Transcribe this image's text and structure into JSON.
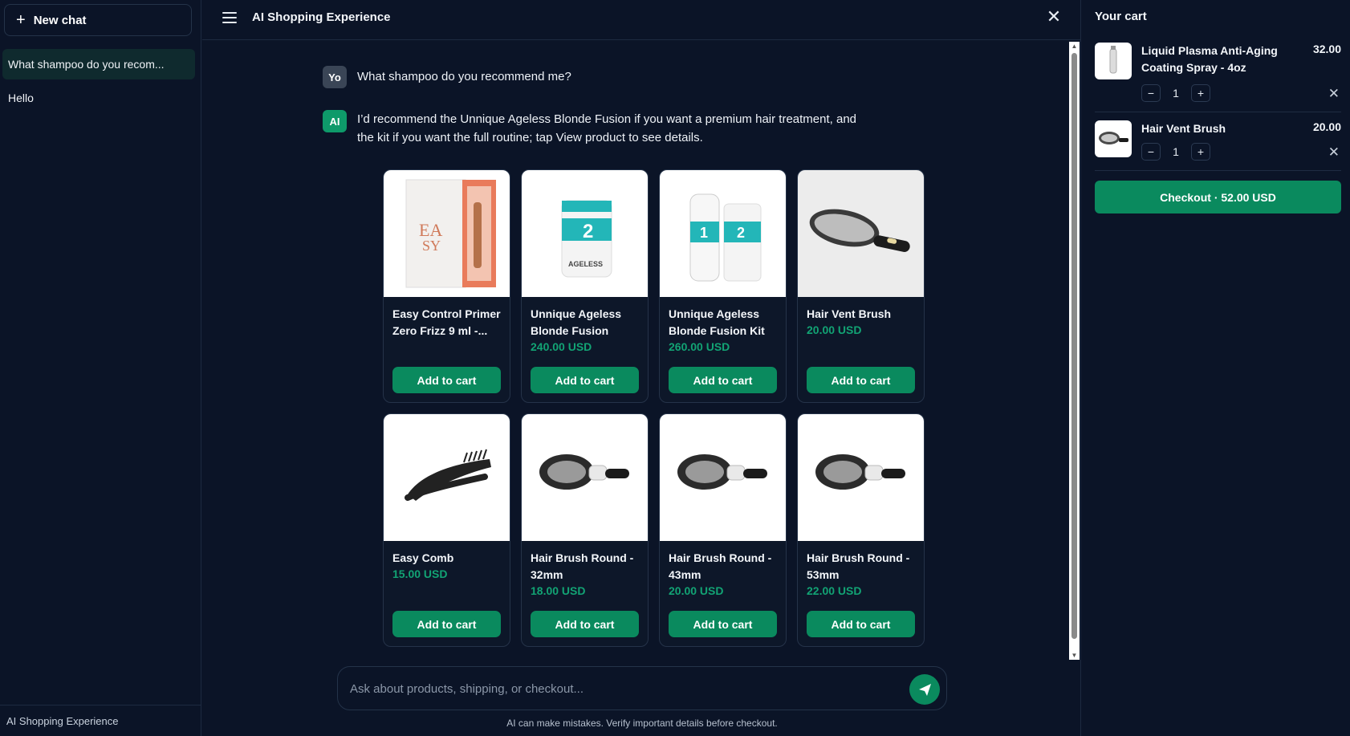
{
  "sidebar": {
    "new_chat_label": "New chat",
    "history": [
      "What shampoo do you recom...",
      "Hello"
    ],
    "footer": "AI Shopping Experience"
  },
  "header": {
    "title": "AI Shopping Experience"
  },
  "conversation": {
    "user_avatar": "Yo",
    "user_message": "What shampoo do you recommend me?",
    "ai_avatar": "AI",
    "ai_message": "I’d recommend the Unnique Ageless Blonde Fusion if you want a premium hair treatment, and the kit if you want the full routine; tap View product to see details."
  },
  "products": [
    {
      "name": "Easy Control Primer Zero Frizz 9 ml -...",
      "price": "",
      "button": "Add to cart",
      "image": "primer-box"
    },
    {
      "name": "Unnique Ageless Blonde Fusion",
      "price": "240.00 USD",
      "button": "Add to cart",
      "image": "jar"
    },
    {
      "name": "Unnique Ageless Blonde Fusion Kit",
      "price": "260.00 USD",
      "button": "Add to cart",
      "image": "kit"
    },
    {
      "name": "Hair Vent Brush",
      "price": "20.00 USD",
      "button": "Add to cart",
      "image": "vent-brush"
    },
    {
      "name": "Easy Comb",
      "price": "15.00 USD",
      "button": "Add to cart",
      "image": "comb"
    },
    {
      "name": "Hair Brush Round - 32mm",
      "price": "18.00 USD",
      "button": "Add to cart",
      "image": "round-brush"
    },
    {
      "name": "Hair Brush Round - 43mm",
      "price": "20.00 USD",
      "button": "Add to cart",
      "image": "round-brush"
    },
    {
      "name": "Hair Brush Round - 53mm",
      "price": "22.00 USD",
      "button": "Add to cart",
      "image": "round-brush"
    }
  ],
  "composer": {
    "placeholder": "Ask about products, shipping, or checkout...",
    "disclaimer": "AI can make mistakes. Verify important details before checkout."
  },
  "cart": {
    "title": "Your cart",
    "items": [
      {
        "name": "Liquid Plasma Anti-Aging Coating Spray - 4oz",
        "price": "32.00",
        "qty": "1"
      },
      {
        "name": "Hair Vent Brush",
        "price": "20.00",
        "qty": "1"
      }
    ],
    "checkout_label": "Checkout · 52.00 USD"
  },
  "colors": {
    "accent": "#0a8a5e",
    "price": "#12a374",
    "background": "#0b1427"
  }
}
